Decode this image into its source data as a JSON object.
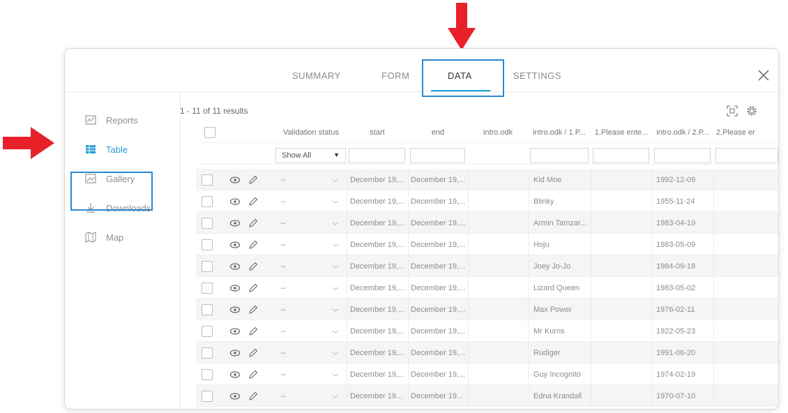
{
  "tabs": [
    "SUMMARY",
    "FORM",
    "DATA",
    "SETTINGS"
  ],
  "active_tab": "DATA",
  "sidebar": {
    "items": [
      {
        "label": "Reports",
        "icon": "reports-icon"
      },
      {
        "label": "Table",
        "icon": "table-icon"
      },
      {
        "label": "Gallery",
        "icon": "gallery-icon"
      },
      {
        "label": "Downloads",
        "icon": "downloads-icon"
      },
      {
        "label": "Map",
        "icon": "map-icon"
      }
    ],
    "active": "Table"
  },
  "results_text": "1 - 11 of 11 results",
  "table": {
    "headers": [
      "Validation status",
      "start",
      "end",
      "intro.odk",
      "intro.odk / 1.P...",
      "1.Please ente...",
      "intro.odk / 2.P...",
      "2.Please er"
    ],
    "filter_select": "Show All",
    "validation_placeholder": "–",
    "rows": [
      {
        "start": "December 19,...",
        "end": "December 19,...",
        "name": "Kid Moe",
        "date": "1992-12-09"
      },
      {
        "start": "December 19,...",
        "end": "December 19,...",
        "name": "Blinky",
        "date": "1955-11-24"
      },
      {
        "start": "December 19,...",
        "end": "December 19,...",
        "name": "Armin Tamzar...",
        "date": "1983-04-19"
      },
      {
        "start": "December 19,...",
        "end": "December 19,...",
        "name": "Hoju",
        "date": "1983-05-09"
      },
      {
        "start": "December 19,...",
        "end": "December 19,...",
        "name": "Joey Jo-Jo",
        "date": "1984-09-18"
      },
      {
        "start": "December 19,...",
        "end": "December 19,...",
        "name": "Lizard Queen",
        "date": "1983-05-02"
      },
      {
        "start": "December 19,...",
        "end": "December 19,...",
        "name": "Max Power",
        "date": "1976-02-11"
      },
      {
        "start": "December 19,...",
        "end": "December 19,...",
        "name": "Mr Kurns",
        "date": "1922-05-23"
      },
      {
        "start": "December 19,...",
        "end": "December 19,...",
        "name": "Rudiger",
        "date": "1991-06-20"
      },
      {
        "start": "December 19,...",
        "end": "December 19,...",
        "name": "Guy Incognito",
        "date": "1974-02-19"
      },
      {
        "start": "December 19...",
        "end": "December 19...",
        "name": "Edna Krandall",
        "date": "1970-07-10"
      }
    ]
  },
  "colors": {
    "accent": "#2a9fd8",
    "annotation_arrow": "#e8202a",
    "annotation_box": "#2a87d0"
  }
}
